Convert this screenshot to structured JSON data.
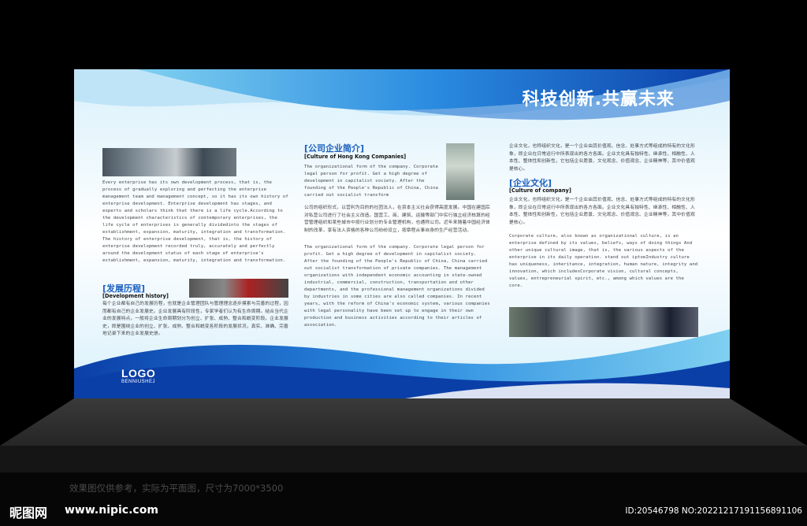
{
  "colors": {
    "accent": "#1b5fbf",
    "deep_blue": "#0b3fa8",
    "light_blue": "#bfe4f7"
  },
  "slogan": "科技创新.共赢未来",
  "logo": {
    "text": "LOGO",
    "sub": "BENNIUSHEJ"
  },
  "col1": {
    "paragraph": "Every enterprise has its own development process, that is, the process of gradually exploring and perfecting the enterprise management team and management concept, so it has its own history of enterprise development. Enterprise development has stages, and experts and scholars think that there is a life cycle.According to the development characteristics of contemporary enterprises, the life cycle of enterprises is generally dividedinto the stages of establishment, expansion, maturity, integration and transformation. The history of enterprise development, that is, the history of enterprise development recorded truly, accurately and perfectly around the development status of each stage of enterprise's establishment, expansion, maturity, integration and transformation.",
    "heading": "[发展历程]",
    "subheading": "[Development history]",
    "chinese": "每个企业都有自己的发展历程，也就是企业管理团队与管理理念逐步摸索与完善的过程，因而都有自己的企业发展史。企业发展具有阶段性，专家学者们认为有生命周期。结合当代企业的发展特点，一般将企业生命周期划分为创立、扩张、成熟、整合和蜕变阶段。企业发展史，即是围绕企业的创立、扩张、成熟、整合和蜕变各阶段的发展状况，真实、准确、完善地记录下来的企业发展史册。"
  },
  "col2": {
    "heading": "[公司企业简介]",
    "subheading": "[Culture of Hong Kong Companies]",
    "para1": "The organizational form of the company. Corporate legal person for profit. Get a high degree of development in capitalist society. After the founding of the People's Republic of China, China carried out socialist transform",
    "chinese": "公司的组织形式，以营利为目的的社团法人，在资本主义社会获得高度发展。中国在建国后对私营公司进行了社会主义改造。国营工、商、建筑、运输等部门中实行独立经济核算的经营管理组织和某些城市中按行业划分的专业管理机构，也通称公司。近年来随着中国经济体制的改革，享有法人资格的各种公司纷纷设立，按章程从事自身的生产经营活动。",
    "para2": "The organizational form of the company. Corporate legal person for profit. Get a high degree of development in capitalist society. After the founding of the People's Republic of China, China carried out socialist transformation of private companies. The management organizations with independent economic accounting in state-owned industrial, commercial, construction, transportation and other departments, and the professional management organizations divided by industries in some cities are also called companies. In recent years, with the reform of China's economic system, various companies with legal personality have been set up to engage in their own production and business activities according to their articles of association."
  },
  "col3": {
    "chinese1": "企业文化，也称组织文化，是一个企业由其价值观、信念、处事方式等组成的特有的文化形象，即企业在日常运行中所表现出的各方各面。企业文化具有独特性、继承性、相融性、人本性、整体性和创新性，它包括企业愿景、文化观念、价值观念、企业精神等，其中价值观是核心。",
    "heading": "[企业文化]",
    "subheading": "[Culture of company]",
    "chinese2": "企业文化，也称组织文化，是一个企业由其价值观、信念、处事方式等组成的特有的文化形象，即企业在日常运行中所表现出的各方各面。企业文化具有独特性、继承性、相融性、人本性、整体性和创新性，它包括企业愿景、文化观念、价值观念、企业精神等，其中价值观是核心。",
    "english": "Corporate culture, also known as organizational culture, is an enterprise defined by its values, beliefs, ways of doing things And other unique cultural image, that is, the various aspects of the enterprise in its daily operation. stand out iptoeIndustry culture has uniqueness, inheritance, integration, human nature, integrity and innovation, which includesCorporate vision, cultural concepts, values, entrepreneurial spirit, etc., among which values are the core."
  },
  "caption": "效果图仅供参考，实际为平面图，尺寸为7000*3500",
  "watermark": {
    "brand": "昵图网",
    "url": "www.nipic.com"
  },
  "image_id": "ID:20546798 NO:20221217191156891106"
}
